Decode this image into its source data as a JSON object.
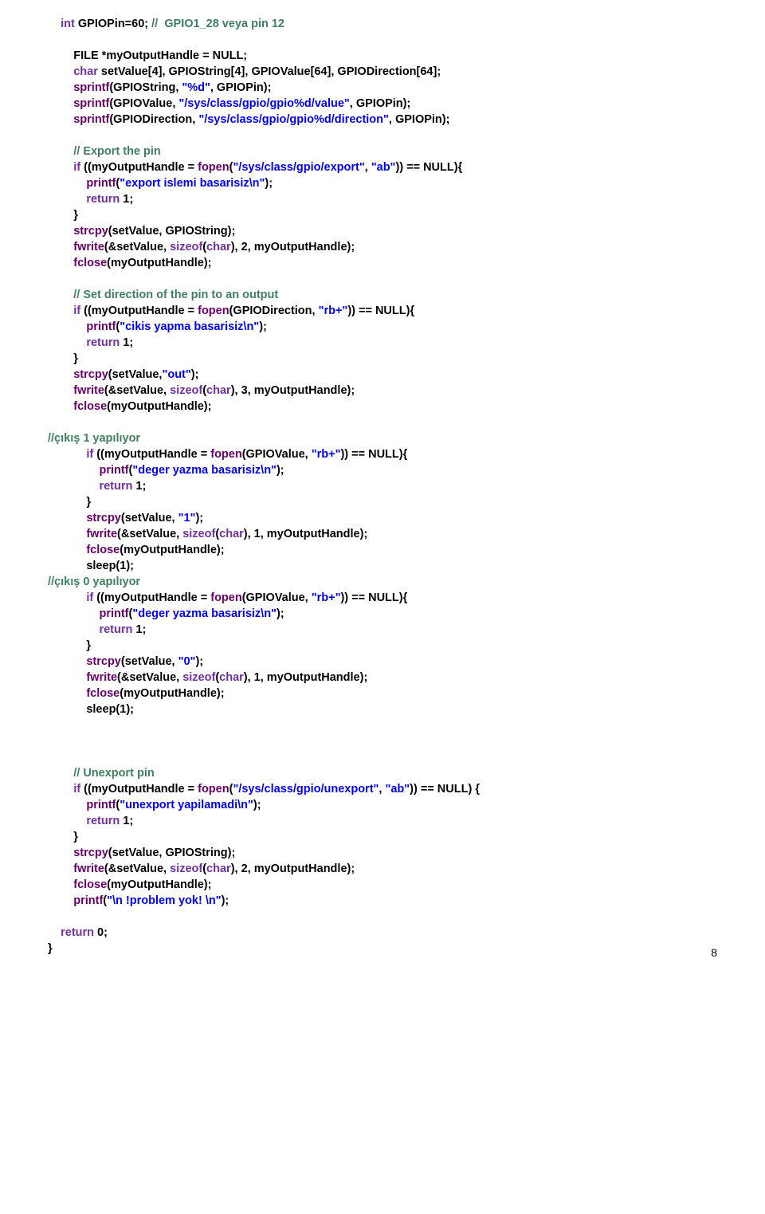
{
  "code": {
    "l01a": "int",
    "l01b": " GPIOPin=60; ",
    "l01c": "//  GPIO1_28 veya pin 12",
    "l02a": "        FILE *myOutputHandle = NULL;",
    "l03a": "        ",
    "l03b": "char",
    "l03c": " setValue[4], GPIOString[4], GPIOValue[64], GPIODirection[64];",
    "l04a": "        ",
    "l04b": "sprintf",
    "l04c": "(GPIOString, ",
    "l04d": "\"%d\"",
    "l04e": ", GPIOPin);",
    "l05a": "        ",
    "l05b": "sprintf",
    "l05c": "(GPIOValue, ",
    "l05d": "\"/sys/class/gpio/gpio%d/value\"",
    "l05e": ", GPIOPin);",
    "l06a": "        ",
    "l06b": "sprintf",
    "l06c": "(GPIODirection, ",
    "l06d": "\"/sys/class/gpio/gpio%d/direction\"",
    "l06e": ", GPIOPin);",
    "l07a": "        ",
    "l07b": "// Export the pin",
    "l08a": "        ",
    "l08b": "if",
    "l08c": " ((myOutputHandle = ",
    "l08d": "fopen",
    "l08e": "(",
    "l08f": "\"/sys/class/gpio/export\"",
    "l08g": ", ",
    "l08h": "\"ab\"",
    "l08i": ")) == NULL){",
    "l09a": "            ",
    "l09b": "printf",
    "l09c": "(",
    "l09d": "\"export islemi basarisiz\\n\"",
    "l09e": ");",
    "l10a": "            ",
    "l10b": "return",
    "l10c": " 1;",
    "l11a": "        }",
    "l12a": "        ",
    "l12b": "strcpy",
    "l12c": "(setValue, GPIOString);",
    "l13a": "        ",
    "l13b": "fwrite",
    "l13c": "(&setValue, ",
    "l13d": "sizeof",
    "l13e": "(",
    "l13f": "char",
    "l13g": "), 2, myOutputHandle);",
    "l14a": "        ",
    "l14b": "fclose",
    "l14c": "(myOutputHandle);",
    "l15a": "        ",
    "l15b": "// Set direction of the pin to an output",
    "l16a": "        ",
    "l16b": "if",
    "l16c": " ((myOutputHandle = ",
    "l16d": "fopen",
    "l16e": "(GPIODirection, ",
    "l16f": "\"rb+\"",
    "l16g": ")) == NULL){",
    "l17a": "            ",
    "l17b": "printf",
    "l17c": "(",
    "l17d": "\"cikis yapma basarisiz\\n\"",
    "l17e": ");",
    "l18a": "            ",
    "l18b": "return",
    "l18c": " 1;",
    "l19a": "        }",
    "l20a": "        ",
    "l20b": "strcpy",
    "l20c": "(setValue,",
    "l20d": "\"out\"",
    "l20e": ");",
    "l21a": "        ",
    "l21b": "fwrite",
    "l21c": "(&setValue, ",
    "l21d": "sizeof",
    "l21e": "(",
    "l21f": "char",
    "l21g": "), 3, myOutputHandle);",
    "l22a": "        ",
    "l22b": "fclose",
    "l22c": "(myOutputHandle);",
    "l23a": "//çıkış 1 yapılıyor",
    "l24a": "            ",
    "l24b": "if",
    "l24c": " ((myOutputHandle = ",
    "l24d": "fopen",
    "l24e": "(GPIOValue, ",
    "l24f": "\"rb+\"",
    "l24g": ")) == NULL){",
    "l25a": "                ",
    "l25b": "printf",
    "l25c": "(",
    "l25d": "\"deger yazma basarisiz\\n\"",
    "l25e": ");",
    "l26a": "                ",
    "l26b": "return",
    "l26c": " 1;",
    "l27a": "            }",
    "l28a": "            ",
    "l28b": "strcpy",
    "l28c": "(setValue, ",
    "l28d": "\"1\"",
    "l28e": ");",
    "l29a": "            ",
    "l29b": "fwrite",
    "l29c": "(&setValue, ",
    "l29d": "sizeof",
    "l29e": "(",
    "l29f": "char",
    "l29g": "), 1, myOutputHandle);",
    "l30a": "            ",
    "l30b": "fclose",
    "l30c": "(myOutputHandle);",
    "l31a": "            sleep(1);",
    "l32a": "//çıkış 0 yapılıyor",
    "l33a": "            ",
    "l33b": "if",
    "l33c": " ((myOutputHandle = ",
    "l33d": "fopen",
    "l33e": "(GPIOValue, ",
    "l33f": "\"rb+\"",
    "l33g": ")) == NULL){",
    "l34a": "                ",
    "l34b": "printf",
    "l34c": "(",
    "l34d": "\"deger yazma basarisiz\\n\"",
    "l34e": ");",
    "l35a": "                ",
    "l35b": "return",
    "l35c": " 1;",
    "l36a": "            }",
    "l37a": "            ",
    "l37b": "strcpy",
    "l37c": "(setValue, ",
    "l37d": "\"0\"",
    "l37e": ");",
    "l38a": "            ",
    "l38b": "fwrite",
    "l38c": "(&setValue, ",
    "l38d": "sizeof",
    "l38e": "(",
    "l38f": "char",
    "l38g": "), 1, myOutputHandle);",
    "l39a": "            ",
    "l39b": "fclose",
    "l39c": "(myOutputHandle);",
    "l40a": "            sleep(1);",
    "l41a": "        ",
    "l41b": "// Unexport pin",
    "l42a": "        ",
    "l42b": "if",
    "l42c": " ((myOutputHandle = ",
    "l42d": "fopen",
    "l42e": "(",
    "l42f": "\"/sys/class/gpio/unexport\"",
    "l42g": ", ",
    "l42h": "\"ab\"",
    "l42i": ")) == NULL) {",
    "l43a": "            ",
    "l43b": "printf",
    "l43c": "(",
    "l43d": "\"unexport yapilamadi\\n\"",
    "l43e": ");",
    "l44a": "            ",
    "l44b": "return",
    "l44c": " 1;",
    "l45a": "        }",
    "l46a": "        ",
    "l46b": "strcpy",
    "l46c": "(setValue, GPIOString);",
    "l47a": "        ",
    "l47b": "fwrite",
    "l47c": "(&setValue, ",
    "l47d": "sizeof",
    "l47e": "(",
    "l47f": "char",
    "l47g": "), 2, myOutputHandle);",
    "l48a": "        ",
    "l48b": "fclose",
    "l48c": "(myOutputHandle);",
    "l49a": "        ",
    "l49b": "printf",
    "l49c": "(",
    "l49d": "\"\\n !problem yok! \\n\"",
    "l49e": ");",
    "l50a": "    ",
    "l50b": "return",
    "l50c": " 0;",
    "l51a": "}"
  },
  "pagenum": "8"
}
